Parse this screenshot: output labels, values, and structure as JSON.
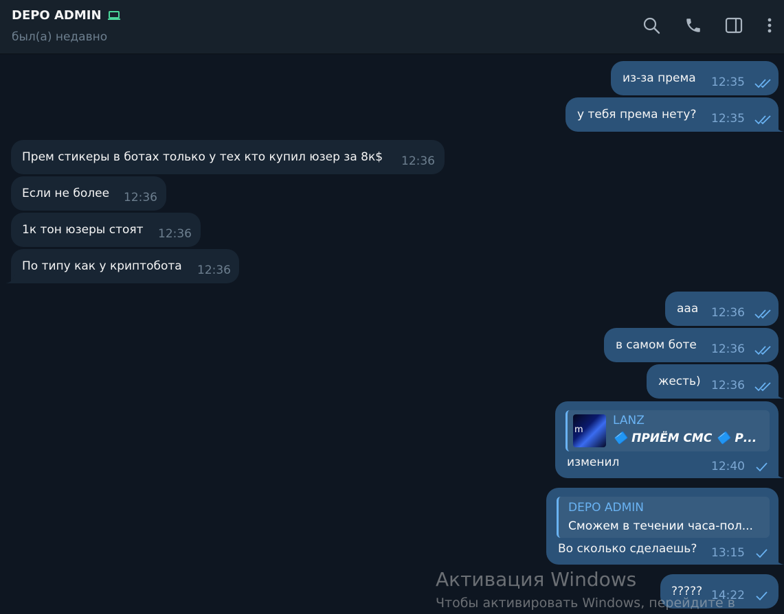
{
  "header": {
    "chat_name": "DEPO ADMIN",
    "status": "был(а) недавно",
    "icons": [
      "search-icon",
      "phone-icon",
      "sidebar-toggle-icon",
      "more-vert-icon"
    ]
  },
  "colors": {
    "background": "#0e1621",
    "header": "#17212b",
    "bubble_out": "#2b5278",
    "bubble_in": "#182533",
    "accent": "#6ab3f3",
    "online_icon": "#4bd69a"
  },
  "messages": [
    {
      "dir": "out",
      "text": "из-за према",
      "time": "12:35",
      "read": true
    },
    {
      "dir": "out",
      "text": "у тебя према нету?",
      "time": "12:35",
      "read": true
    },
    {
      "dir": "in",
      "text": "Прем стикеры в ботах только у тех кто купил юзер за 8к$",
      "time": "12:36"
    },
    {
      "dir": "in",
      "text": "Если не более",
      "time": "12:36"
    },
    {
      "dir": "in",
      "text": "1к тон юзеры стоят",
      "time": "12:36"
    },
    {
      "dir": "in",
      "text": "По типу как у криптобота",
      "time": "12:36"
    },
    {
      "dir": "out",
      "text": "ааа",
      "time": "12:36",
      "read": true
    },
    {
      "dir": "out",
      "text": "в самом боте",
      "time": "12:36",
      "read": true
    },
    {
      "dir": "out",
      "text": "жесть)",
      "time": "12:36",
      "read": true
    },
    {
      "dir": "out",
      "text": "изменил",
      "time": "12:40",
      "read": false,
      "reply": {
        "name": "LANZ",
        "text": "🔷 ПРИЁМ СМС 🔷 Р...",
        "thumb_text": "m"
      }
    },
    {
      "dir": "out",
      "text": "Во сколько сделаешь?",
      "time": "13:15",
      "read": false,
      "reply": {
        "name": "DEPO ADMIN",
        "text": "Сможем в течении часа-пол..."
      }
    },
    {
      "dir": "out",
      "text": "?????",
      "time": "14:22",
      "read": false
    }
  ],
  "watermark": {
    "title": "Активация Windows",
    "subtitle": "Чтобы активировать Windows, перейдите в"
  }
}
